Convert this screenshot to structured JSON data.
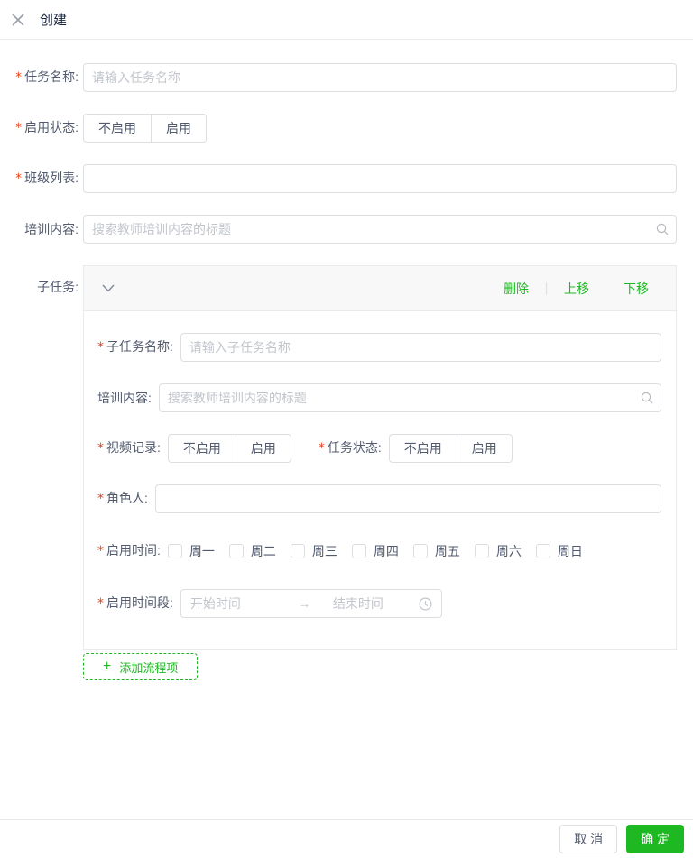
{
  "colors": {
    "accent_green": "#1eb922",
    "required_red": "#ed4014",
    "border": "#dcdee2",
    "panel_header_bg": "#f8f8f9"
  },
  "marks": {
    "required": "*",
    "plus": "+"
  },
  "titlebar": {
    "title": "创建"
  },
  "form": {
    "task_name": {
      "label": "任务名称:",
      "placeholder": "请输入任务名称"
    },
    "enable_status": {
      "label": "启用状态:",
      "options": [
        "不启用",
        "启用"
      ]
    },
    "class_list": {
      "label": "班级列表:"
    },
    "training_content": {
      "label": "培训内容:",
      "placeholder": "搜索教师培训内容的标题"
    },
    "subtask": {
      "label": "子任务:",
      "actions": {
        "delete": "删除",
        "move_up": "上移",
        "move_down": "下移"
      },
      "fields": {
        "subtask_name": {
          "label": "子任务名称:",
          "placeholder": "请输入子任务名称"
        },
        "training_content": {
          "label": "培训内容:",
          "placeholder": "搜索教师培训内容的标题"
        },
        "video_record": {
          "label": "视频记录:",
          "options": [
            "不启用",
            "启用"
          ]
        },
        "task_status": {
          "label": "任务状态:",
          "options": [
            "不启用",
            "启用"
          ]
        },
        "role_person": {
          "label": "角色人:"
        },
        "enable_days": {
          "label": "启用时间:",
          "days": [
            "周一",
            "周二",
            "周三",
            "周四",
            "周五",
            "周六",
            "周日"
          ]
        },
        "enable_period": {
          "label": "启用时间段:",
          "start_placeholder": "开始时间",
          "arrow": "→",
          "end_placeholder": "结束时间"
        }
      }
    },
    "add_button_label": "添加流程项"
  },
  "footer": {
    "cancel": "取 消",
    "confirm": "确 定"
  }
}
